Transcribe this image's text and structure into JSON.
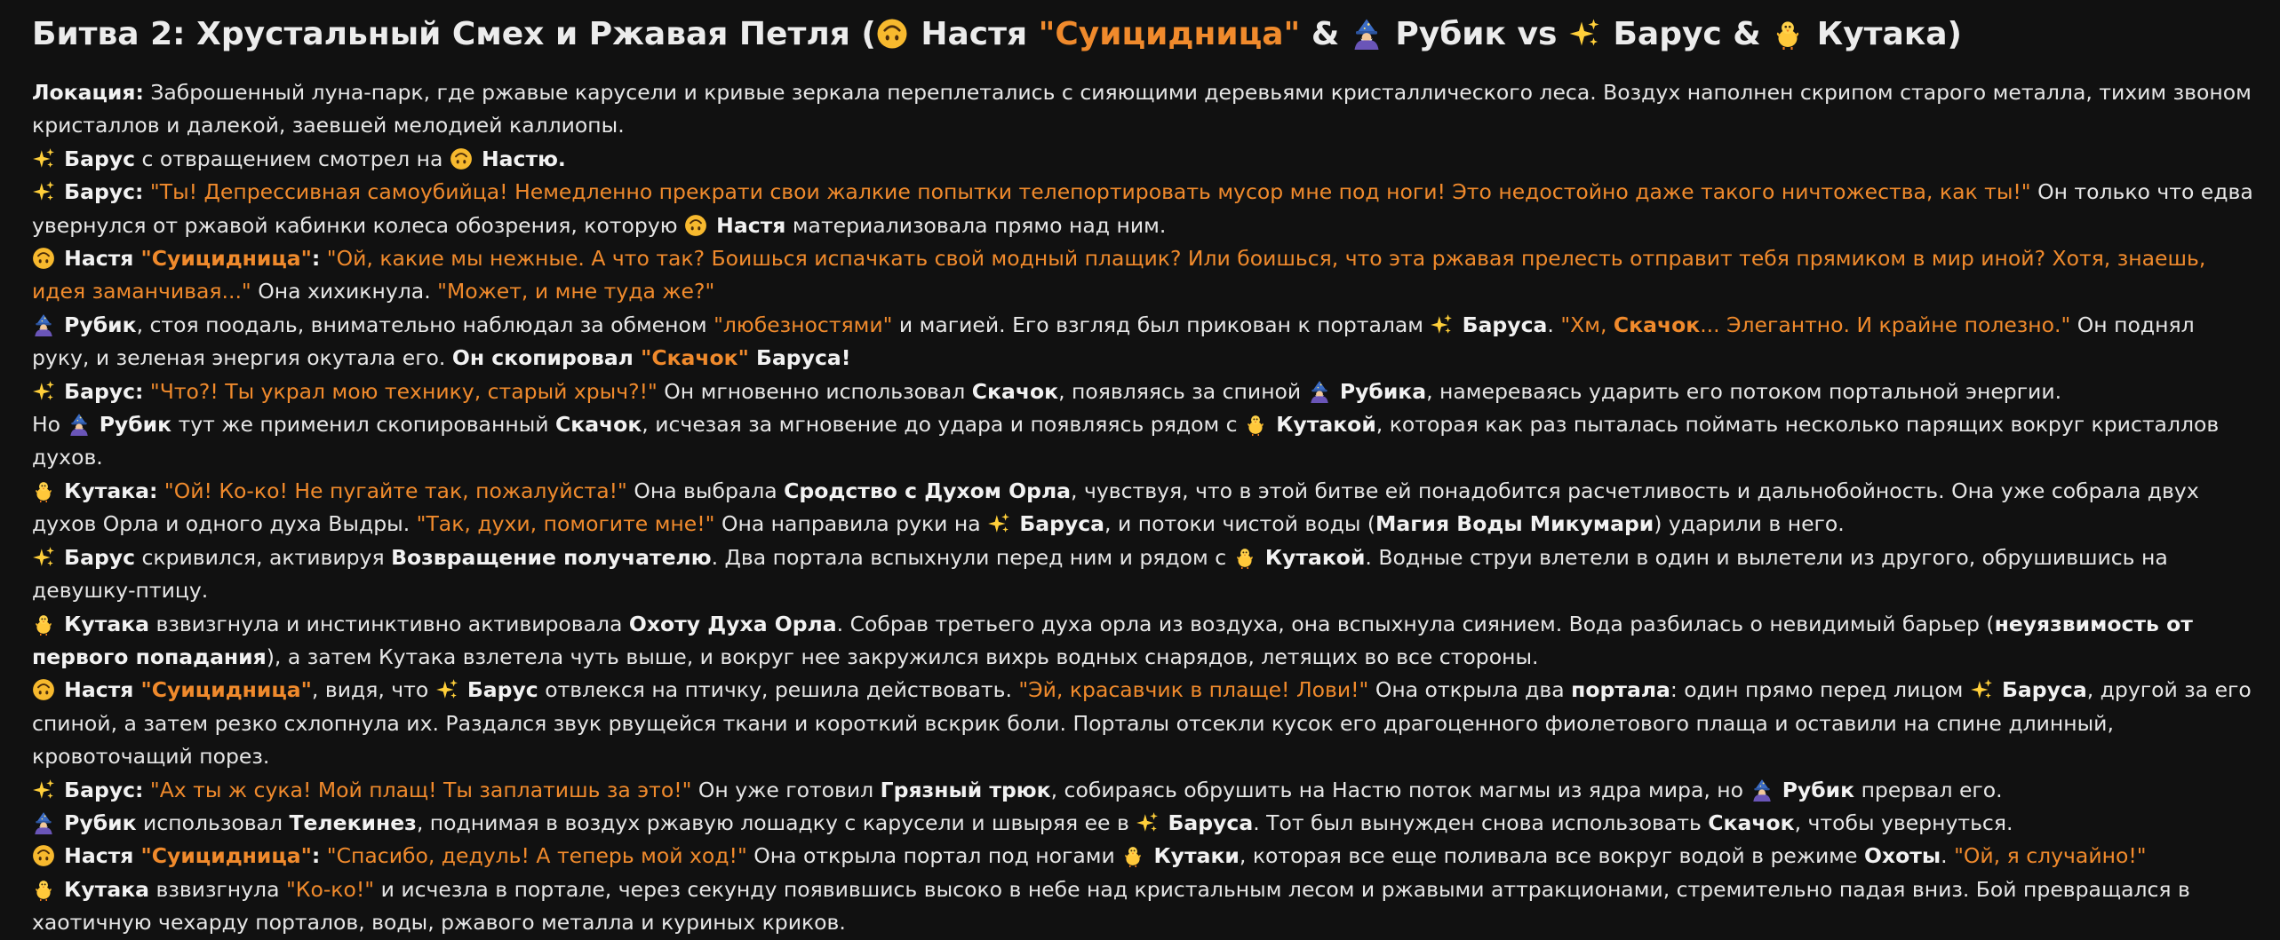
{
  "colors": {
    "background": "#111111",
    "text": "#e6e6e6",
    "accent_quote": "#f08a2c"
  },
  "icons": {
    "upside_down_face": "upside-down-face-emoji",
    "mage": "mage-emoji",
    "sparkles": "sparkles-emoji",
    "baby_chick": "baby-chick-emoji"
  },
  "title": [
    {
      "t": "Битва 2: Хрустальный Смех и Ржавая Петля (",
      "s": "plain"
    },
    {
      "e": "upside"
    },
    {
      "t": " Настя ",
      "s": "plain"
    },
    {
      "t": "\"Суицидница\"",
      "s": "quote"
    },
    {
      "t": " & ",
      "s": "plain"
    },
    {
      "e": "mage"
    },
    {
      "t": " Рубик vs ",
      "s": "plain"
    },
    {
      "e": "sparkles"
    },
    {
      "t": " Барус & ",
      "s": "plain"
    },
    {
      "e": "chick"
    },
    {
      "t": " Кутака)",
      "s": "plain"
    }
  ],
  "paragraphs": [
    [
      {
        "t": "Локация:",
        "s": "bold"
      },
      {
        "t": " Заброшенный луна-парк, где ржавые карусели и кривые зеркала переплетались с сияющими деревьями кристаллического леса. Воздух наполнен скрипом старого металла, тихим звоном кристаллов и далекой, заевшей мелодией каллиопы.",
        "s": "plain"
      }
    ],
    [
      {
        "e": "sparkles"
      },
      {
        "t": " Барус",
        "s": "bold"
      },
      {
        "t": " с отвращением смотрел на ",
        "s": "plain"
      },
      {
        "e": "upside"
      },
      {
        "t": " Настю.",
        "s": "bold"
      }
    ],
    [
      {
        "e": "sparkles"
      },
      {
        "t": " Барус:",
        "s": "bold"
      },
      {
        "t": " ",
        "s": "plain"
      },
      {
        "t": "\"Ты! Депрессивная самоубийца! Немедленно прекрати свои жалкие попытки телепортировать мусор мне под ноги! Это недостойно даже такого ничтожества, как ты!\"",
        "s": "quote"
      },
      {
        "t": " Он только что едва увернулся от ржавой кабинки колеса обозрения, которую ",
        "s": "plain"
      },
      {
        "e": "upside"
      },
      {
        "t": " Настя",
        "s": "bold"
      },
      {
        "t": " материализовала прямо над ним.",
        "s": "plain"
      }
    ],
    [
      {
        "e": "upside"
      },
      {
        "t": " Настя ",
        "s": "bold"
      },
      {
        "t": "\"Суицидница\"",
        "s": "boldquote"
      },
      {
        "t": ":",
        "s": "bold"
      },
      {
        "t": " ",
        "s": "plain"
      },
      {
        "t": "\"Ой, какие мы нежные. А что так? Боишься испачкать свой модный плащик? Или боишься, что эта ржавая прелесть отправит тебя прямиком в мир иной? Хотя, знаешь, идея заманчивая...\"",
        "s": "quote"
      },
      {
        "t": " Она хихикнула. ",
        "s": "plain"
      },
      {
        "t": "\"Может, и мне туда же?\"",
        "s": "quote"
      }
    ],
    [
      {
        "e": "mage"
      },
      {
        "t": " Рубик",
        "s": "bold"
      },
      {
        "t": ", стоя поодаль, внимательно наблюдал за обменом ",
        "s": "plain"
      },
      {
        "t": "\"любезностями\"",
        "s": "quote"
      },
      {
        "t": " и магией. Его взгляд был прикован к порталам ",
        "s": "plain"
      },
      {
        "e": "sparkles"
      },
      {
        "t": " Баруса",
        "s": "bold"
      },
      {
        "t": ". ",
        "s": "plain"
      },
      {
        "t": "\"Хм, ",
        "s": "quote"
      },
      {
        "t": "Скачок",
        "s": "boldquote"
      },
      {
        "t": "... Элегантно. И крайне полезно.\"",
        "s": "quote"
      },
      {
        "t": " Он поднял руку, и зеленая энергия окутала его. ",
        "s": "plain"
      },
      {
        "t": "Он скопировал ",
        "s": "bold"
      },
      {
        "t": "\"Скачок\"",
        "s": "boldquote"
      },
      {
        "t": " Баруса!",
        "s": "bold"
      }
    ],
    [
      {
        "e": "sparkles"
      },
      {
        "t": " Барус:",
        "s": "bold"
      },
      {
        "t": " ",
        "s": "plain"
      },
      {
        "t": "\"Что?! Ты украл мою технику, старый хрыч?!\"",
        "s": "quote"
      },
      {
        "t": " Он мгновенно использовал ",
        "s": "plain"
      },
      {
        "t": "Скачок",
        "s": "bold"
      },
      {
        "t": ", появляясь за спиной ",
        "s": "plain"
      },
      {
        "e": "mage"
      },
      {
        "t": " Рубика",
        "s": "bold"
      },
      {
        "t": ", намереваясь ударить его потоком портальной энергии.",
        "s": "plain"
      }
    ],
    [
      {
        "t": "Но ",
        "s": "plain"
      },
      {
        "e": "mage"
      },
      {
        "t": " Рубик",
        "s": "bold"
      },
      {
        "t": " тут же применил скопированный ",
        "s": "plain"
      },
      {
        "t": "Скачок",
        "s": "bold"
      },
      {
        "t": ", исчезая за мгновение до удара и появляясь рядом с ",
        "s": "plain"
      },
      {
        "e": "chick"
      },
      {
        "t": " Кутакой",
        "s": "bold"
      },
      {
        "t": ", которая как раз пыталась поймать несколько парящих вокруг кристаллов духов.",
        "s": "plain"
      }
    ],
    [
      {
        "e": "chick"
      },
      {
        "t": " Кутака:",
        "s": "bold"
      },
      {
        "t": " ",
        "s": "plain"
      },
      {
        "t": "\"Ой! Ко-ко! Не пугайте так, пожалуйста!\"",
        "s": "quote"
      },
      {
        "t": " Она выбрала ",
        "s": "plain"
      },
      {
        "t": "Сродство с Духом Орла",
        "s": "bold"
      },
      {
        "t": ", чувствуя, что в этой битве ей понадобится расчетливость и дальнобойность. Она уже собрала двух духов Орла и одного духа Выдры. ",
        "s": "plain"
      },
      {
        "t": "\"Так, духи, помогите мне!\"",
        "s": "quote"
      },
      {
        "t": " Она направила руки на ",
        "s": "plain"
      },
      {
        "e": "sparkles"
      },
      {
        "t": " Баруса",
        "s": "bold"
      },
      {
        "t": ", и потоки чистой воды (",
        "s": "plain"
      },
      {
        "t": "Магия Воды Микумари",
        "s": "bold"
      },
      {
        "t": ") ударили в него.",
        "s": "plain"
      }
    ],
    [
      {
        "e": "sparkles"
      },
      {
        "t": " Барус",
        "s": "bold"
      },
      {
        "t": " скривился, активируя ",
        "s": "plain"
      },
      {
        "t": "Возвращение получателю",
        "s": "bold"
      },
      {
        "t": ". Два портала вспыхнули перед ним и рядом с ",
        "s": "plain"
      },
      {
        "e": "chick"
      },
      {
        "t": " Кутакой",
        "s": "bold"
      },
      {
        "t": ". Водные струи влетели в один и вылетели из другого, обрушившись на девушку-птицу.",
        "s": "plain"
      }
    ],
    [
      {
        "e": "chick"
      },
      {
        "t": " Кутака",
        "s": "bold"
      },
      {
        "t": " взвизгнула и инстинктивно активировала ",
        "s": "plain"
      },
      {
        "t": "Охоту Духа Орла",
        "s": "bold"
      },
      {
        "t": ". Собрав третьего духа орла из воздуха, она вспыхнула сиянием. Вода разбилась о невидимый барьер (",
        "s": "plain"
      },
      {
        "t": "неуязвимость от первого попадания",
        "s": "bold"
      },
      {
        "t": "), а затем Кутака взлетела чуть выше, и вокруг нее закружился вихрь водных снарядов, летящих во все стороны.",
        "s": "plain"
      }
    ],
    [
      {
        "e": "upside"
      },
      {
        "t": " Настя ",
        "s": "bold"
      },
      {
        "t": "\"Суицидница\"",
        "s": "boldquote"
      },
      {
        "t": ", видя, что ",
        "s": "plain"
      },
      {
        "e": "sparkles"
      },
      {
        "t": " Барус",
        "s": "bold"
      },
      {
        "t": " отвлекся на птичку, решила действовать. ",
        "s": "plain"
      },
      {
        "t": "\"Эй, красавчик в плаще! Лови!\"",
        "s": "quote"
      },
      {
        "t": " Она открыла два ",
        "s": "plain"
      },
      {
        "t": "портала",
        "s": "bold"
      },
      {
        "t": ": один прямо перед лицом ",
        "s": "plain"
      },
      {
        "e": "sparkles"
      },
      {
        "t": " Баруса",
        "s": "bold"
      },
      {
        "t": ", другой за его спиной, а затем резко схлопнула их. Раздался звук рвущейся ткани и короткий вскрик боли. Порталы отсекли кусок его драгоценного фиолетового плаща и оставили на спине длинный, кровоточащий порез.",
        "s": "plain"
      }
    ],
    [
      {
        "e": "sparkles"
      },
      {
        "t": " Барус:",
        "s": "bold"
      },
      {
        "t": " ",
        "s": "plain"
      },
      {
        "t": "\"Ах ты ж сука! Мой плащ! Ты заплатишь за это!\"",
        "s": "quote"
      },
      {
        "t": " Он уже готовил ",
        "s": "plain"
      },
      {
        "t": "Грязный трюк",
        "s": "bold"
      },
      {
        "t": ", собираясь обрушить на Настю поток магмы из ядра мира, но ",
        "s": "plain"
      },
      {
        "e": "mage"
      },
      {
        "t": " Рубик",
        "s": "bold"
      },
      {
        "t": " прервал его.",
        "s": "plain"
      }
    ],
    [
      {
        "e": "mage"
      },
      {
        "t": " Рубик",
        "s": "bold"
      },
      {
        "t": " использовал ",
        "s": "plain"
      },
      {
        "t": "Телекинез",
        "s": "bold"
      },
      {
        "t": ", поднимая в воздух ржавую лошадку с карусели и швыряя ее в ",
        "s": "plain"
      },
      {
        "e": "sparkles"
      },
      {
        "t": " Баруса",
        "s": "bold"
      },
      {
        "t": ". Тот был вынужден снова использовать ",
        "s": "plain"
      },
      {
        "t": "Скачок",
        "s": "bold"
      },
      {
        "t": ", чтобы увернуться.",
        "s": "plain"
      }
    ],
    [
      {
        "e": "upside"
      },
      {
        "t": " Настя ",
        "s": "bold"
      },
      {
        "t": "\"Суицидница\"",
        "s": "boldquote"
      },
      {
        "t": ":",
        "s": "bold"
      },
      {
        "t": " ",
        "s": "plain"
      },
      {
        "t": "\"Спасибо, дедуль! А теперь мой ход!\"",
        "s": "quote"
      },
      {
        "t": " Она открыла портал под ногами ",
        "s": "plain"
      },
      {
        "e": "chick"
      },
      {
        "t": " Кутаки",
        "s": "bold"
      },
      {
        "t": ", которая все еще поливала все вокруг водой в режиме ",
        "s": "plain"
      },
      {
        "t": "Охоты",
        "s": "bold"
      },
      {
        "t": ". ",
        "s": "plain"
      },
      {
        "t": "\"Ой, я случайно!\"",
        "s": "quote"
      }
    ],
    [
      {
        "e": "chick"
      },
      {
        "t": " Кутака",
        "s": "bold"
      },
      {
        "t": " взвизгнула ",
        "s": "plain"
      },
      {
        "t": "\"Ко-ко!\"",
        "s": "quote"
      },
      {
        "t": " и исчезла в портале, через секунду появившись высоко в небе над кристальным лесом и ржавыми аттракционами, стремительно падая вниз. Бой превращался в хаотичную чехарду порталов, воды, ржавого металла и куриных криков.",
        "s": "plain"
      }
    ]
  ]
}
